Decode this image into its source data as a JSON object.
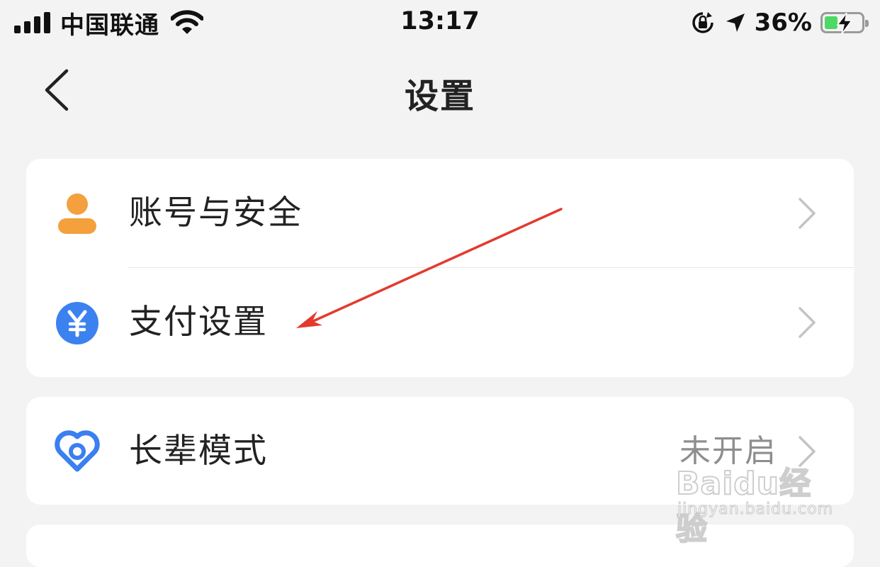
{
  "status_bar": {
    "carrier": "中国联通",
    "time": "13:17",
    "battery_percent": "36%",
    "battery_level": 0.36,
    "signal_bars": 4,
    "icons": [
      "signal-icon",
      "wifi-icon",
      "rotation-lock-icon",
      "location-arrow-icon",
      "battery-charging-icon"
    ]
  },
  "nav": {
    "title": "设置",
    "back_icon": "chevron-left-icon"
  },
  "groups": [
    {
      "items": [
        {
          "label": "账号与安全",
          "icon": "user-icon",
          "icon_color": "#f4a03c"
        },
        {
          "label": "支付设置",
          "icon": "yuan-icon",
          "icon_color": "#3b82f0"
        }
      ]
    },
    {
      "items": [
        {
          "label": "长辈模式",
          "value": "未开启",
          "icon": "heart-icon",
          "icon_color": "#3b7ff0"
        }
      ]
    }
  ],
  "watermark": {
    "brand": "Baidu经验",
    "url": "jingyan.baidu.com"
  },
  "colors": {
    "background": "#f3f3f3",
    "card": "#ffffff",
    "annotation_arrow": "#e23b2e"
  }
}
